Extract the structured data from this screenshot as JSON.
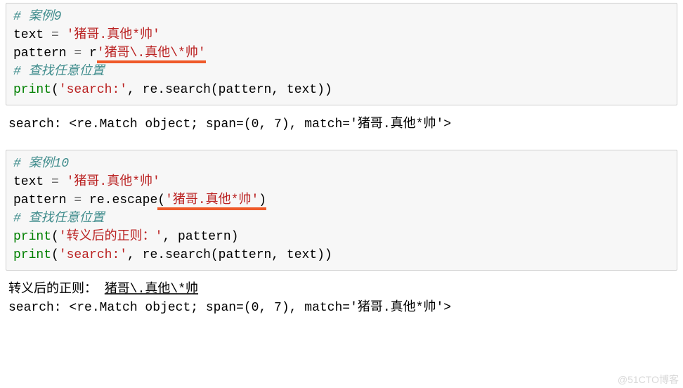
{
  "block1": {
    "comment1": "# 案例9",
    "line2_var": "text ",
    "line2_eq": "=",
    "line2_str": " '猪哥.真他*帅'",
    "line3_var": "pattern ",
    "line3_eq": "=",
    "line3_r": " r",
    "line3_str_ul": "'猪哥\\.真他\\*帅'",
    "comment4": "# 查找任意位置",
    "line5_print": "print",
    "line5_open": "(",
    "line5_str": "'search:'",
    "line5_mid": ", re",
    "line5_dotsearch": ".search(pattern, text))"
  },
  "output1": {
    "text": "search: <re.Match object; span=(0, 7), match='猪哥.真他*帅'>"
  },
  "block2": {
    "comment1": "# 案例10",
    "line2_var": "text ",
    "line2_eq": "=",
    "line2_str": " '猪哥.真他*帅'",
    "line3_var": "pattern ",
    "line3_eq": "=",
    "line3_mid": " re",
    "line3_esc": ".escape",
    "line3_open": "(",
    "line3_str_ul": "'猪哥.真他*帅'",
    "line3_close": ")",
    "comment4": "# 查找任意位置",
    "line5_print": "print",
    "line5_open": "(",
    "line5_str": "'转义后的正则：'",
    "line5_rest": ", pattern)",
    "line6_print": "print",
    "line6_open": "(",
    "line6_str": "'search:'",
    "line6_rest": ", re",
    "line6_search": ".search(pattern, text))"
  },
  "output2": {
    "line1_pre": "转义后的正则： ",
    "line1_ul": "猪哥\\.真他\\*帅",
    "line2": "search: <re.Match object; span=(0, 7), match='猪哥.真他*帅'>"
  },
  "watermark": "@51CTO博客"
}
